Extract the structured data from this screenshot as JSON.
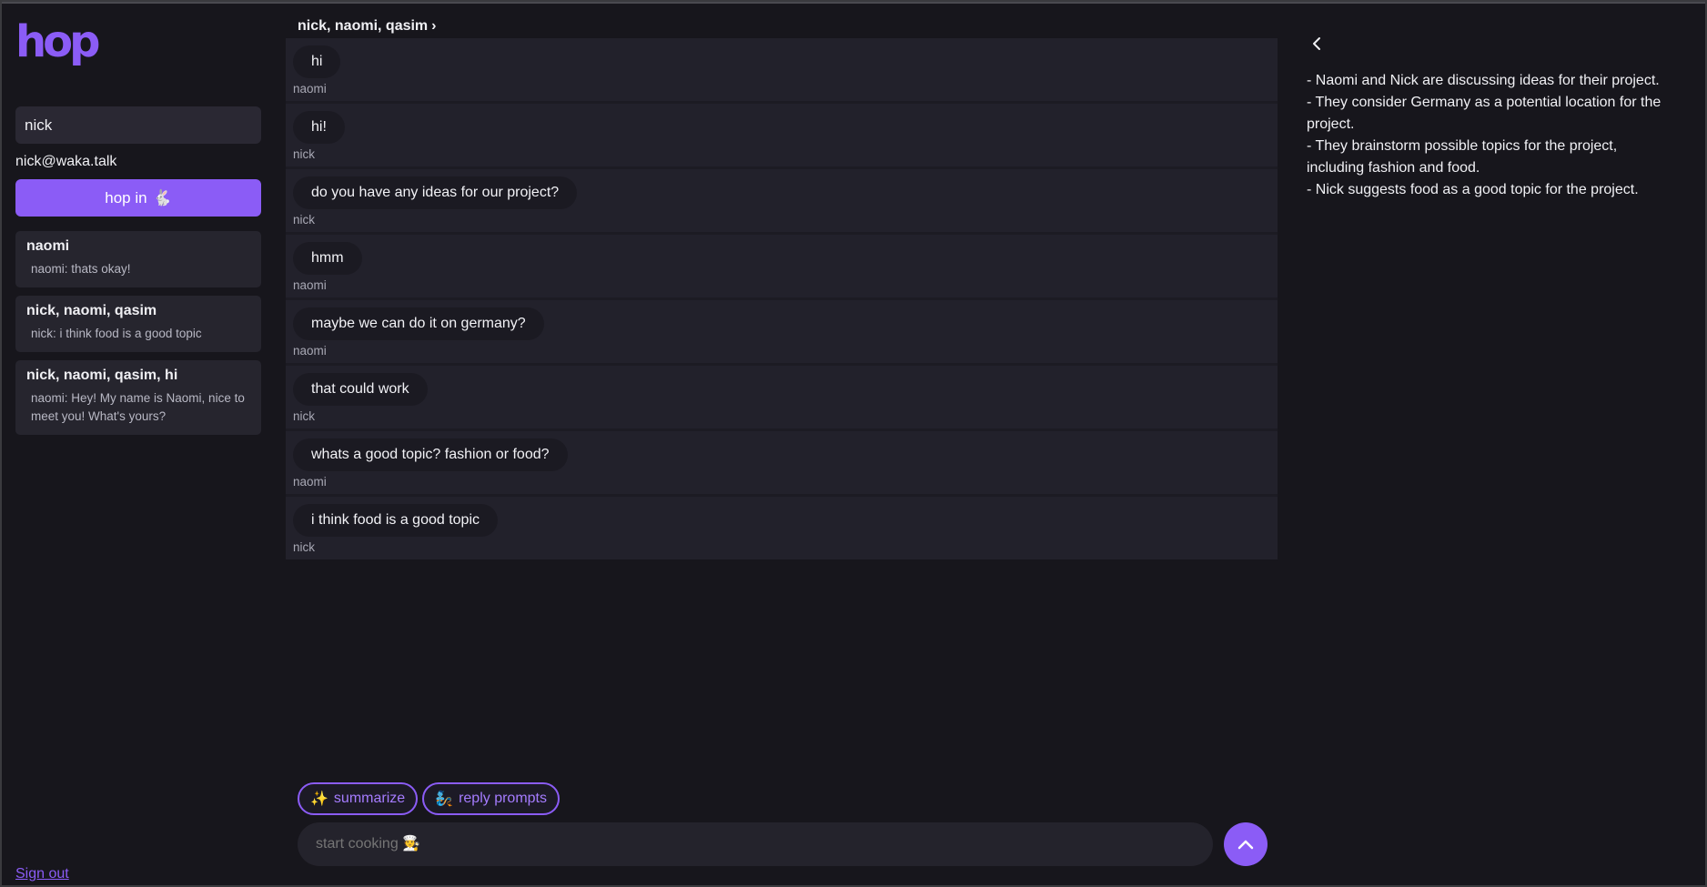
{
  "brand": {
    "logo_text": "hop",
    "accent": "#8b5cf6"
  },
  "sidebar": {
    "username_value": "nick",
    "email": "nick@waka.talk",
    "hop_button_label": "hop in",
    "hop_button_icon": "🐇",
    "conversations": [
      {
        "title": "naomi",
        "preview": "naomi: thats okay!"
      },
      {
        "title": "nick, naomi, qasim",
        "preview": "nick: i think food is a good topic"
      },
      {
        "title": "nick, naomi, qasim, hi",
        "preview": "naomi: Hey! My name is Naomi, nice to meet you! What's yours?"
      }
    ],
    "signout_label": "Sign out"
  },
  "chat": {
    "header_title": "nick, naomi, qasim",
    "header_chevron": "›",
    "messages": [
      {
        "text": "hi",
        "author": "naomi"
      },
      {
        "text": "hi!",
        "author": "nick"
      },
      {
        "text": "do you have any ideas for our project?",
        "author": "nick"
      },
      {
        "text": "hmm",
        "author": "naomi"
      },
      {
        "text": "maybe we can do it on germany?",
        "author": "naomi"
      },
      {
        "text": "that could work",
        "author": "nick"
      },
      {
        "text": "whats a good topic? fashion or food?",
        "author": "naomi"
      },
      {
        "text": "i think food is a good topic",
        "author": "nick"
      }
    ],
    "chips": [
      {
        "icon": "✨",
        "label": "summarize"
      },
      {
        "icon": "🧞",
        "label": "reply prompts"
      }
    ],
    "composer_placeholder": "start cooking 🧑‍🍳"
  },
  "summary": {
    "lines": [
      "- Naomi and Nick are discussing ideas for their project.",
      "- They consider Germany as a potential location for the project.",
      "- They brainstorm possible topics for the project, including fashion and food.",
      "- Nick suggests food as a good topic for the project."
    ]
  }
}
